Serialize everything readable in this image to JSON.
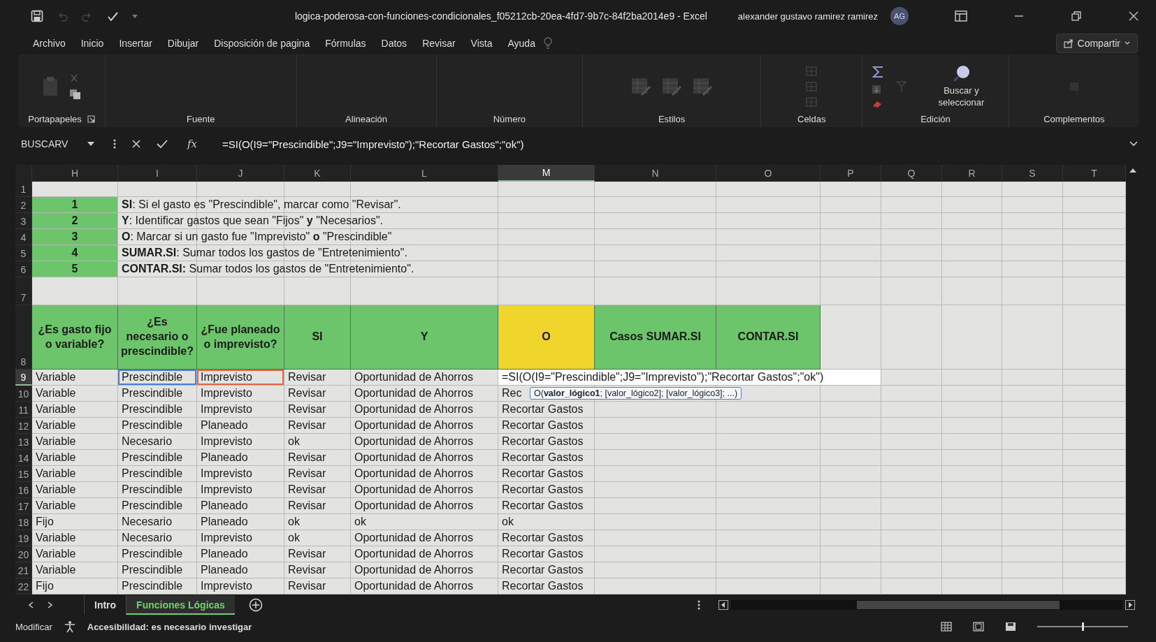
{
  "window": {
    "title": "logica-poderosa-con-funciones-condicionales_f05212cb-20ea-4fd7-9b7c-84f2ba2014e9  -  Excel",
    "user": "alexander gustavo ramirez ramirez",
    "avatar": "AG"
  },
  "ribbon_tabs": [
    "Archivo",
    "Inicio",
    "Insertar",
    "Dibujar",
    "Disposición de pagina",
    "Fórmulas",
    "Datos",
    "Revisar",
    "Vista",
    "Ayuda"
  ],
  "share_button": "Compartir",
  "ribbon_groups": [
    {
      "label": "Portapapeles",
      "kind": "clipboard"
    },
    {
      "label": "Fuente",
      "kind": "font"
    },
    {
      "label": "Alineación",
      "kind": "align"
    },
    {
      "label": "Número",
      "kind": "number"
    },
    {
      "label": "Estilos",
      "kind": "styles"
    },
    {
      "label": "Celdas",
      "kind": "cells"
    },
    {
      "label": "Edición",
      "kind": "editing",
      "button": "Buscar y seleccionar"
    },
    {
      "label": "Complementos",
      "kind": "addins"
    }
  ],
  "formula_bar": {
    "name_box": "BUSCARV",
    "function_button": "fx",
    "formula": "=SI(O(I9=\"Prescindible\";J9=\"Imprevisto\");\"Recortar Gastos\";\"ok\")"
  },
  "sheet": {
    "columns": [
      {
        "label": "H",
        "selected": false
      },
      {
        "label": "I",
        "selected": false
      },
      {
        "label": "J",
        "selected": false
      },
      {
        "label": "K",
        "selected": false
      },
      {
        "label": "L",
        "selected": false
      },
      {
        "label": "M",
        "selected": true
      },
      {
        "label": "N",
        "selected": false
      },
      {
        "label": "O",
        "selected": false
      },
      {
        "label": "P",
        "selected": false
      },
      {
        "label": "Q",
        "selected": false
      },
      {
        "label": "R",
        "selected": false
      },
      {
        "label": "S",
        "selected": false
      },
      {
        "label": "T",
        "selected": false
      }
    ],
    "row_numbers": [
      {
        "label": "1",
        "selected": false
      },
      {
        "label": "2",
        "selected": false
      },
      {
        "label": "3",
        "selected": false
      },
      {
        "label": "4",
        "selected": false
      },
      {
        "label": "5",
        "selected": false
      },
      {
        "label": "6",
        "selected": false
      },
      {
        "label": "7",
        "selected": false
      },
      {
        "label": "8",
        "selected": false
      },
      {
        "label": "9",
        "selected": true
      },
      {
        "label": "10",
        "selected": false
      },
      {
        "label": "11",
        "selected": false
      },
      {
        "label": "12",
        "selected": false
      },
      {
        "label": "13",
        "selected": false
      },
      {
        "label": "14",
        "selected": false
      },
      {
        "label": "15",
        "selected": false
      },
      {
        "label": "16",
        "selected": false
      },
      {
        "label": "17",
        "selected": false
      },
      {
        "label": "18",
        "selected": false
      },
      {
        "label": "19",
        "selected": false
      },
      {
        "label": "20",
        "selected": false
      },
      {
        "label": "21",
        "selected": false
      },
      {
        "label": "22",
        "selected": false
      }
    ],
    "instructions": [
      {
        "number": "1",
        "text": "**SI**: Si el gasto es \"Prescindible\", marcar como \"Revisar\"."
      },
      {
        "number": "2",
        "text": "**Y**: Identificar gastos que sean \"Fijos\" **y** \"Necesarios\"."
      },
      {
        "number": "3",
        "text": "**O**: Marcar si un gasto fue \"Imprevisto\" **o** \"Prescindible\""
      },
      {
        "number": "4",
        "text": "**SUMAR.SI**: Sumar todos los gastos de \"Entretenimiento\"."
      },
      {
        "number": "5",
        "text": "**CONTAR.SI:** Sumar todos los gastos de \"Entretenimiento\"."
      }
    ],
    "headers": [
      {
        "text": "¿Es gasto fijo o variable?",
        "color": "#6cc56a"
      },
      {
        "text": "¿Es necesario o prescindible?",
        "color": "#6cc56a"
      },
      {
        "text": "¿Fue planeado o imprevisto?",
        "color": "#6cc56a"
      },
      {
        "text": "SI",
        "color": "#6cc56a"
      },
      {
        "text": "Y",
        "color": "#6cc56a"
      },
      {
        "text": "O",
        "color": "#f0d62c"
      },
      {
        "text": "Casos SUMAR.SI",
        "color": "#6cc56a"
      },
      {
        "text": "CONTAR.SI",
        "color": "#6cc56a"
      }
    ],
    "data_rows": [
      {
        "editing": true,
        "cells": [
          "Variable",
          "Prescindible",
          "Imprevisto",
          "Revisar",
          "Oportunidad de Ahorros",
          "=SI(O(I9=\"Prescindible\";J9=\"Imprevisto\");\"Recortar Gastos\";\"ok\")"
        ]
      },
      {
        "editing": false,
        "cells": [
          "Variable",
          "Prescindible",
          "Imprevisto",
          "Revisar",
          "Oportunidad de Ahorros",
          "Rec"
        ]
      },
      {
        "editing": false,
        "cells": [
          "Variable",
          "Prescindible",
          "Imprevisto",
          "Revisar",
          "Oportunidad de Ahorros",
          "Recortar Gastos"
        ]
      },
      {
        "editing": false,
        "cells": [
          "Variable",
          "Prescindible",
          "Planeado",
          "Revisar",
          "Oportunidad de Ahorros",
          "Recortar Gastos"
        ]
      },
      {
        "editing": false,
        "cells": [
          "Variable",
          "Necesario",
          "Imprevisto",
          "ok",
          "Oportunidad de Ahorros",
          "Recortar Gastos"
        ]
      },
      {
        "editing": false,
        "cells": [
          "Variable",
          "Prescindible",
          "Planeado",
          "Revisar",
          "Oportunidad de Ahorros",
          "Recortar Gastos"
        ]
      },
      {
        "editing": false,
        "cells": [
          "Variable",
          "Prescindible",
          "Imprevisto",
          "Revisar",
          "Oportunidad de Ahorros",
          "Recortar Gastos"
        ]
      },
      {
        "editing": false,
        "cells": [
          "Variable",
          "Prescindible",
          "Imprevisto",
          "Revisar",
          "Oportunidad de Ahorros",
          "Recortar Gastos"
        ]
      },
      {
        "editing": false,
        "cells": [
          "Variable",
          "Prescindible",
          "Planeado",
          "Revisar",
          "Oportunidad de Ahorros",
          "Recortar Gastos"
        ]
      },
      {
        "editing": false,
        "cells": [
          "Fijo",
          "Necesario",
          "Planeado",
          "ok",
          "ok",
          "ok"
        ]
      },
      {
        "editing": false,
        "cells": [
          "Variable",
          "Necesario",
          "Imprevisto",
          "ok",
          "Oportunidad de Ahorros",
          "Recortar Gastos"
        ]
      },
      {
        "editing": false,
        "cells": [
          "Variable",
          "Prescindible",
          "Planeado",
          "Revisar",
          "Oportunidad de Ahorros",
          "Recortar Gastos"
        ]
      },
      {
        "editing": false,
        "cells": [
          "Variable",
          "Prescindible",
          "Planeado",
          "Revisar",
          "Oportunidad de Ahorros",
          "Recortar Gastos"
        ]
      },
      {
        "editing": false,
        "cells": [
          "Fijo",
          "Prescindible",
          "Imprevisto",
          "Revisar",
          "Oportunidad de Ahorros",
          "Recortar Gastos"
        ]
      }
    ],
    "formula_refs": [
      {
        "color": "#4a7fd8"
      },
      {
        "color": "#e0663c"
      }
    ],
    "function_tooltip": "O(**valor_lógico1**; [valor_lógico2]; [valor_lógico3]; ...)"
  },
  "sheet_tabs": [
    {
      "label": "Intro",
      "selected": false
    },
    {
      "label": "Funciones Lógicas",
      "selected": true
    }
  ],
  "status_bar": {
    "mode": "Modificar",
    "accessibility": "Accesibilidad: es necesario investigar",
    "zoom": {
      "level": 0.5
    }
  }
}
